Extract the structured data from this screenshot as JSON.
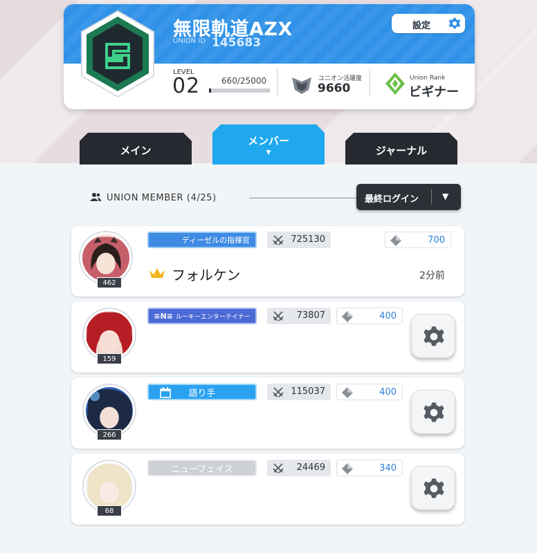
{
  "union": {
    "name": "無限軌道AZX",
    "id_label": "UNION ID",
    "id": "145683",
    "settings_label": "設定",
    "level_label": "LEVEL",
    "level": "02",
    "xp_text": "660/25000",
    "xp_fraction": 0.0264,
    "activity_label": "ユニオン活躍度",
    "activity": "9660",
    "rank_label": "Union Rank",
    "rank": "ビギナー"
  },
  "tabs": [
    {
      "label": "メイン"
    },
    {
      "label": "メンバー",
      "arrow": "▼"
    },
    {
      "label": "ジャーナル"
    }
  ],
  "members_header": {
    "title": "UNION MEMBER (4/25)",
    "sort_label": "最終ログイン",
    "sort_caret": "▼"
  },
  "members": [
    {
      "level": "462",
      "title": "ディーゼルの指揮官",
      "power": "725130",
      "points": "700",
      "name": "フォルケン",
      "last_login": "2分前",
      "leader": true
    },
    {
      "level": "159",
      "title": "ルーキーエンターテイナー",
      "title_prefix": "≡N≡",
      "power": "73807",
      "points": "400"
    },
    {
      "level": "266",
      "title": "語り手",
      "power": "115037",
      "points": "400"
    },
    {
      "level": "68",
      "title": "ニューフェイス",
      "power": "24469",
      "points": "340"
    }
  ],
  "colors": {
    "header_blue": "#2f92e8",
    "tab_active": "#1fa8ee",
    "tab_dark": "#262a30",
    "emblem_green": "#1c7a52",
    "points_blue": "#2c7fd6"
  }
}
